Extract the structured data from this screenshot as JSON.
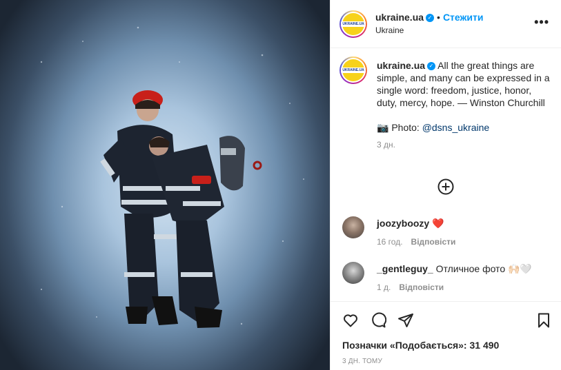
{
  "post": {
    "author": "ukraine.ua",
    "avatar_text": "UKRAINE.UA",
    "follow_label": "Стежити",
    "location": "Ukraine",
    "more_label": "•••",
    "caption_text": "All the great things are simple, and many can be expressed in a single word: freedom, justice, honor, duty, mercy, hope. — Winston Churchill",
    "photo_credit_prefix": "📷 Photo: ",
    "photo_credit_handle": "@dsns_ukraine",
    "caption_time": "3 дн."
  },
  "comments": [
    {
      "user": "joozyboozy",
      "text": "❤️",
      "time": "16 год.",
      "reply_label": "Відповісти"
    },
    {
      "user": "_gentleguy_",
      "text": "Отличное фото 🙌🏻🤍",
      "time": "1 д.",
      "reply_label": "Відповісти"
    }
  ],
  "footer": {
    "likes_text": "Позначки «Подобається»: 31 490",
    "time_ago": "3 ДН. ТОМУ"
  },
  "colors": {
    "accent": "#0095f6",
    "link": "#00376b",
    "muted": "#8e8e8e"
  },
  "icons": [
    "heart-icon",
    "comment-icon",
    "share-icon",
    "bookmark-icon",
    "add-comment-icon",
    "more-icon",
    "verified-icon"
  ]
}
